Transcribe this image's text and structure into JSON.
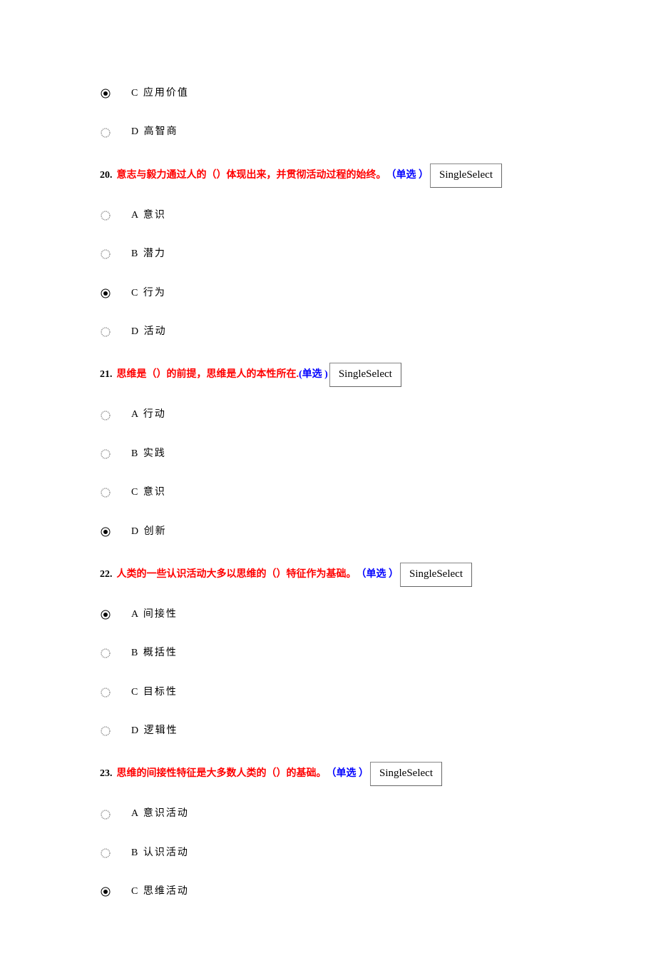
{
  "badge_label": "SingleSelect",
  "orphan_options": [
    {
      "label": "C 应用价值",
      "checked": true
    },
    {
      "label": "D 高智商",
      "checked": false
    }
  ],
  "questions": [
    {
      "num": "20.",
      "text": "意志与毅力通过人的（）体现出来，并贯彻活动过程的始终。",
      "type": "（单选 ）",
      "options": [
        {
          "label": "A 意识",
          "checked": false
        },
        {
          "label": "B 潜力",
          "checked": false
        },
        {
          "label": "C 行为",
          "checked": true
        },
        {
          "label": "D 活动",
          "checked": false
        }
      ]
    },
    {
      "num": "21.",
      "text": "思维是（）的前提，思维是人的本性所在.",
      "type": "(单选 )",
      "options": [
        {
          "label": "A 行动",
          "checked": false
        },
        {
          "label": "B 实践",
          "checked": false
        },
        {
          "label": "C 意识",
          "checked": false
        },
        {
          "label": "D 创新",
          "checked": true
        }
      ]
    },
    {
      "num": "22.",
      "text": "人类的一些认识活动大多以思维的（）特征作为基础。",
      "type": "（单选 ）",
      "options": [
        {
          "label": "A 间接性",
          "checked": true
        },
        {
          "label": "B 概括性",
          "checked": false
        },
        {
          "label": "C 目标性",
          "checked": false
        },
        {
          "label": "D 逻辑性",
          "checked": false
        }
      ]
    },
    {
      "num": "23.",
      "text": "思维的间接性特征是大多数人类的（）的基础。",
      "type": "（单选 ）",
      "options": [
        {
          "label": "A 意识活动",
          "checked": false
        },
        {
          "label": "B 认识活动",
          "checked": false
        },
        {
          "label": "C 思维活动",
          "checked": true
        }
      ]
    }
  ]
}
